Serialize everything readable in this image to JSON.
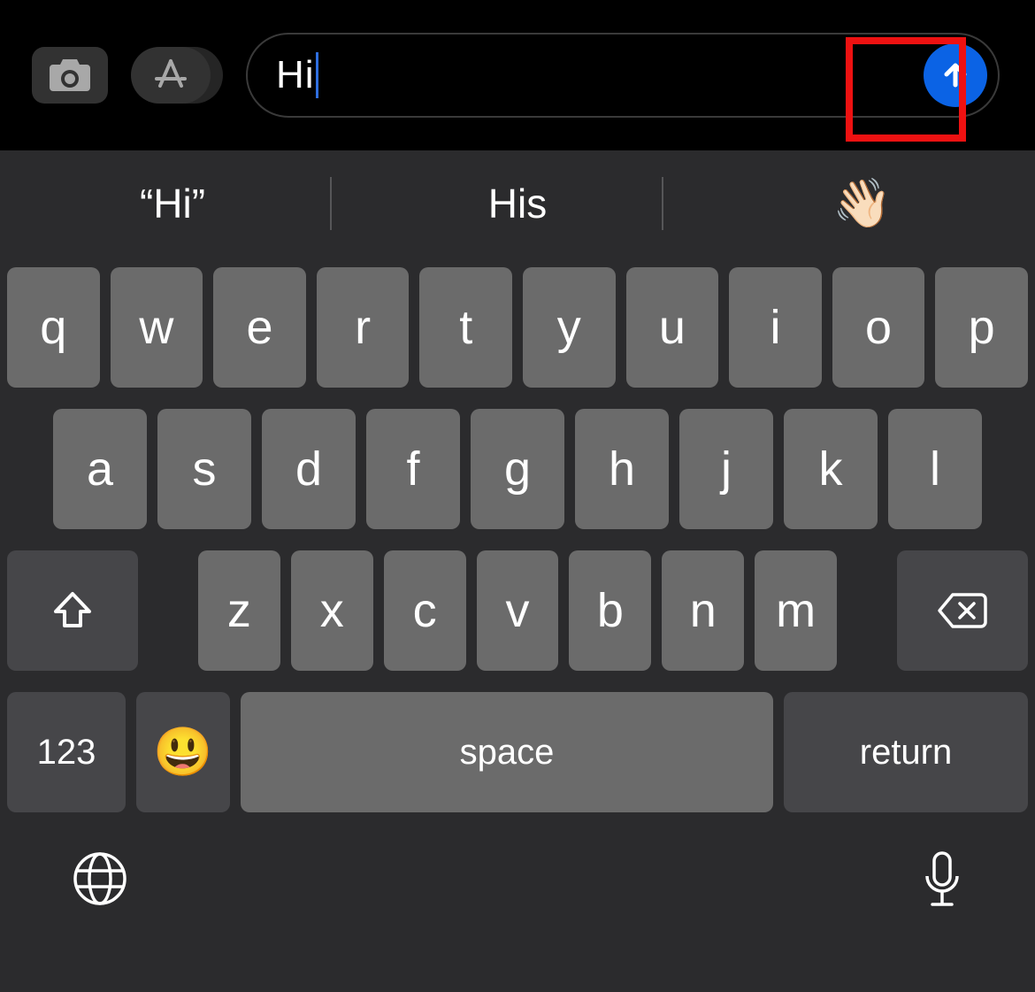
{
  "composer": {
    "input_value": "Hi",
    "camera_icon": "camera",
    "appstore_icon": "app-store",
    "send_icon": "arrow-up"
  },
  "highlight": {
    "target": "send-button"
  },
  "suggestions": {
    "items": [
      "“Hi”",
      "His",
      "👋🏻"
    ]
  },
  "keyboard": {
    "row1": [
      "q",
      "w",
      "e",
      "r",
      "t",
      "y",
      "u",
      "i",
      "o",
      "p"
    ],
    "row2": [
      "a",
      "s",
      "d",
      "f",
      "g",
      "h",
      "j",
      "k",
      "l"
    ],
    "row3": [
      "z",
      "x",
      "c",
      "v",
      "b",
      "n",
      "m"
    ],
    "shift_icon": "shift",
    "backspace_icon": "backspace",
    "numbers_label": "123",
    "emoji_icon": "😃",
    "space_label": "space",
    "return_label": "return",
    "globe_icon": "globe",
    "mic_icon": "microphone"
  },
  "colors": {
    "send_button": "#0b63e5",
    "highlight_border": "#e11",
    "key_bg": "#6b6b6b",
    "fn_key_bg": "#464649",
    "keyboard_bg": "#2b2b2d"
  }
}
